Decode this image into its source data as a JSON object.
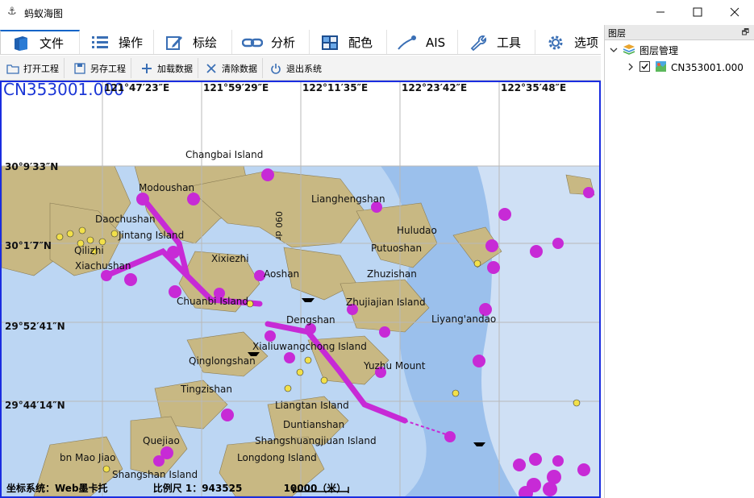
{
  "window": {
    "title": "蚂蚁海图",
    "minimize": "—",
    "maximize": "☐",
    "close": "✕"
  },
  "tabs": [
    {
      "label": "文件",
      "icon": "book-icon"
    },
    {
      "label": "操作",
      "icon": "list-icon"
    },
    {
      "label": "标绘",
      "icon": "edit-icon"
    },
    {
      "label": "分析",
      "icon": "link-icon"
    },
    {
      "label": "配色",
      "icon": "grid-icon"
    },
    {
      "label": "AIS",
      "icon": "satellite-icon"
    },
    {
      "label": "工具",
      "icon": "wrench-icon"
    },
    {
      "label": "选项",
      "icon": "gear-icon"
    }
  ],
  "toolbar": {
    "open": "打开工程",
    "save_as": "另存工程",
    "load": "加载数据",
    "clear": "清除数据",
    "exit": "退出系统"
  },
  "map": {
    "chart_id": "CN353001.000",
    "longitudes": [
      "121°47′23″E",
      "121°59′29″E",
      "122°11′35″E",
      "122°23′42″E",
      "122°35′48″E"
    ],
    "latitudes": [
      "30°9′33″N",
      "30°1′7″N",
      "29°52′41″N",
      "29°44′14″N"
    ],
    "places": [
      "Changbai Island",
      "Modoushan",
      "Lianghengshan",
      "Daochushan",
      "Jintang Island",
      "Huludao",
      "Putuoshan",
      "Qilizhi",
      "Xiachushan",
      "Xixiezhi",
      "Aoshan",
      "Zhuzishan",
      "Chuanbi Island",
      "Zhujiajian Island",
      "Dengshan",
      "Liyang'andao",
      "Xialiuwangchong Island",
      "Qinglongshan",
      "Yuzhu Mount",
      "Tingzishan",
      "Liangtan Island",
      "Duntianshan",
      "Quejiao",
      "Shangshuangjiuan Island",
      "bn Mao Jiao",
      "Longdong Island",
      "Shangshan Island"
    ],
    "depth_contour_label": "090 dr",
    "coord_system_label": "坐标系统：Web墨卡托",
    "scale_label": "比例尺 1：943525",
    "scalebar_label": "10000（米）"
  },
  "panel": {
    "title": "图层",
    "pin": "🗗",
    "root_label": "图层管理",
    "layer_label": "CN353001.000",
    "layer_checked": true
  },
  "colors": {
    "land": "#c8b883",
    "shallow": "#bcd6f3",
    "mid": "#9bc0ec",
    "deep": "#cfe0f5",
    "route": "#c72ad6",
    "frame": "#1a2de0"
  }
}
